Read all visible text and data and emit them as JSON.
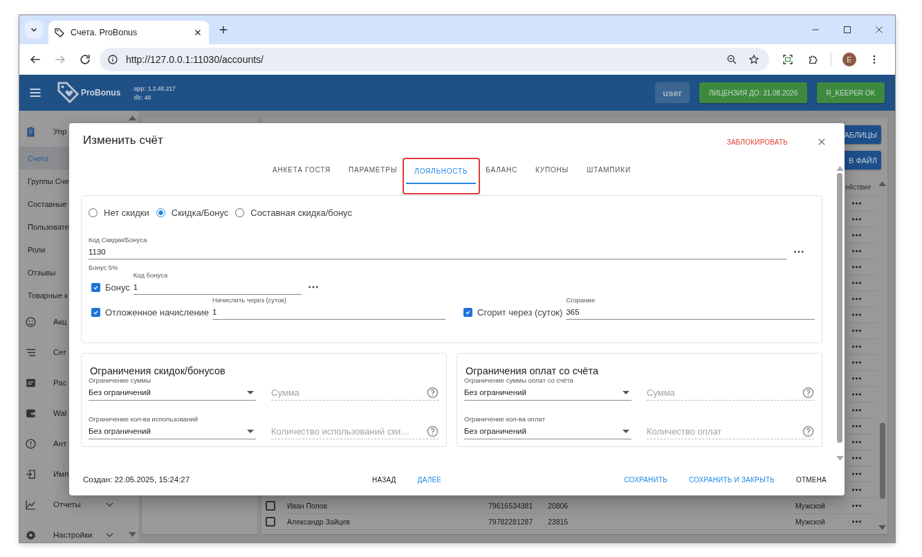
{
  "browser": {
    "tab_title": "Счета. ProBonus",
    "url": "http://127.0.0.1:11030/accounts/",
    "profile_initial": "E"
  },
  "app_header": {
    "brand": "ProBonus",
    "app_version": "app: 1.2.40.217",
    "db_version": "db: 40",
    "user": "user",
    "license": "ЛИЦЕНЗИЯ ДО: 31.08.2026",
    "status": "R_KEEPER OK"
  },
  "sidebar": {
    "items": [
      {
        "label": "Упр",
        "expanded": true,
        "children": [
          {
            "label": "Счета",
            "selected": true
          },
          {
            "label": "Группы Сче",
            "selected": false
          },
          {
            "label": "Составные",
            "selected": false
          },
          {
            "label": "Пользовате",
            "selected": false
          },
          {
            "label": "Роли",
            "selected": false
          },
          {
            "label": "Отзывы",
            "selected": false
          },
          {
            "label": "Товарные к",
            "selected": false
          }
        ]
      },
      {
        "label": "Акц"
      },
      {
        "label": "Сег"
      },
      {
        "label": "Рас"
      },
      {
        "label": "Wal"
      },
      {
        "label": "Ант"
      },
      {
        "label": "Имп"
      },
      {
        "label": "Отчеты",
        "expanded": false
      },
      {
        "label": "Настройки",
        "expanded": false
      }
    ]
  },
  "toolbar_buttons": [
    "АБЛИЦЫ",
    "В ФАЙЛ"
  ],
  "table": {
    "columns": [
      "ействие"
    ],
    "rows": [
      {
        "checked": false,
        "cells": [
          "Иван Попов",
          "79616534381",
          "20806",
          "Мужской"
        ]
      },
      {
        "checked": false,
        "cells": [
          "Александр Зайцев",
          "79782281287",
          "23815",
          "Мужской"
        ]
      }
    ]
  },
  "dialog": {
    "title": "Изменить счёт",
    "block_action": "ЗАБЛОКИРОВАТЬ",
    "tabs": [
      {
        "label": "АНКЕТА ГОСТЯ",
        "selected": false
      },
      {
        "label": "ПАРАМЕТРЫ",
        "selected": false
      },
      {
        "label": "ЛОЯЛЬНОСТЬ",
        "selected": true
      },
      {
        "label": "БАЛАНС",
        "selected": false
      },
      {
        "label": "КУПОНЫ",
        "selected": false
      },
      {
        "label": "ШТАМПИКИ",
        "selected": false
      }
    ],
    "discount_modes": [
      {
        "label": "Нет скидки",
        "selected": false
      },
      {
        "label": "Скидка/Бонус",
        "selected": true
      },
      {
        "label": "Составная скидка/бонус",
        "selected": false
      }
    ],
    "discount_code": {
      "label": "Код Скидки/Бонуса",
      "value": "1130",
      "hint": "Бонус 5%"
    },
    "bonus": {
      "checked": true,
      "label": "Бонус",
      "field_label": "Код бонуса",
      "value": "1"
    },
    "deferred": {
      "checked": true,
      "label": "Отложенное начисление",
      "field_label": "Начислить через (суток)",
      "value": "1"
    },
    "expiry": {
      "checked": true,
      "label": "Сгорит через (суток)",
      "field_label": "Сгорание",
      "value": "365"
    },
    "limit_panels": [
      {
        "title": "Ограничения скидок/бонусов",
        "rows": [
          {
            "select_label": "Ограничение суммы",
            "select_value": "Без ограничений",
            "placeholder": "Сумма"
          },
          {
            "select_label": "Ограничение кол-ва использований",
            "select_value": "Без ограничений",
            "placeholder": "Количество использований ски…"
          }
        ]
      },
      {
        "title": "Ограничения оплат со счёта",
        "rows": [
          {
            "select_label": "Ограничение суммы оплат со счёта",
            "select_value": "Без ограничений",
            "placeholder": "Сумма"
          },
          {
            "select_label": "Ограничение кол-ва оплат",
            "select_value": "Без ограничений",
            "placeholder": "Количество оплат"
          }
        ]
      }
    ],
    "created": "Создан: 22.05.2025, 15:24:27",
    "nav_buttons": [
      {
        "label": "НАЗАД",
        "kind": "plain"
      },
      {
        "label": "ДАЛЕЕ",
        "kind": "accent"
      }
    ],
    "action_buttons": [
      {
        "label": "СОХРАНИТЬ",
        "kind": "accent"
      },
      {
        "label": "СОХРАНИТЬ И ЗАКРЫТЬ",
        "kind": "accent"
      },
      {
        "label": "ОТМЕНА",
        "kind": "plain"
      }
    ]
  }
}
